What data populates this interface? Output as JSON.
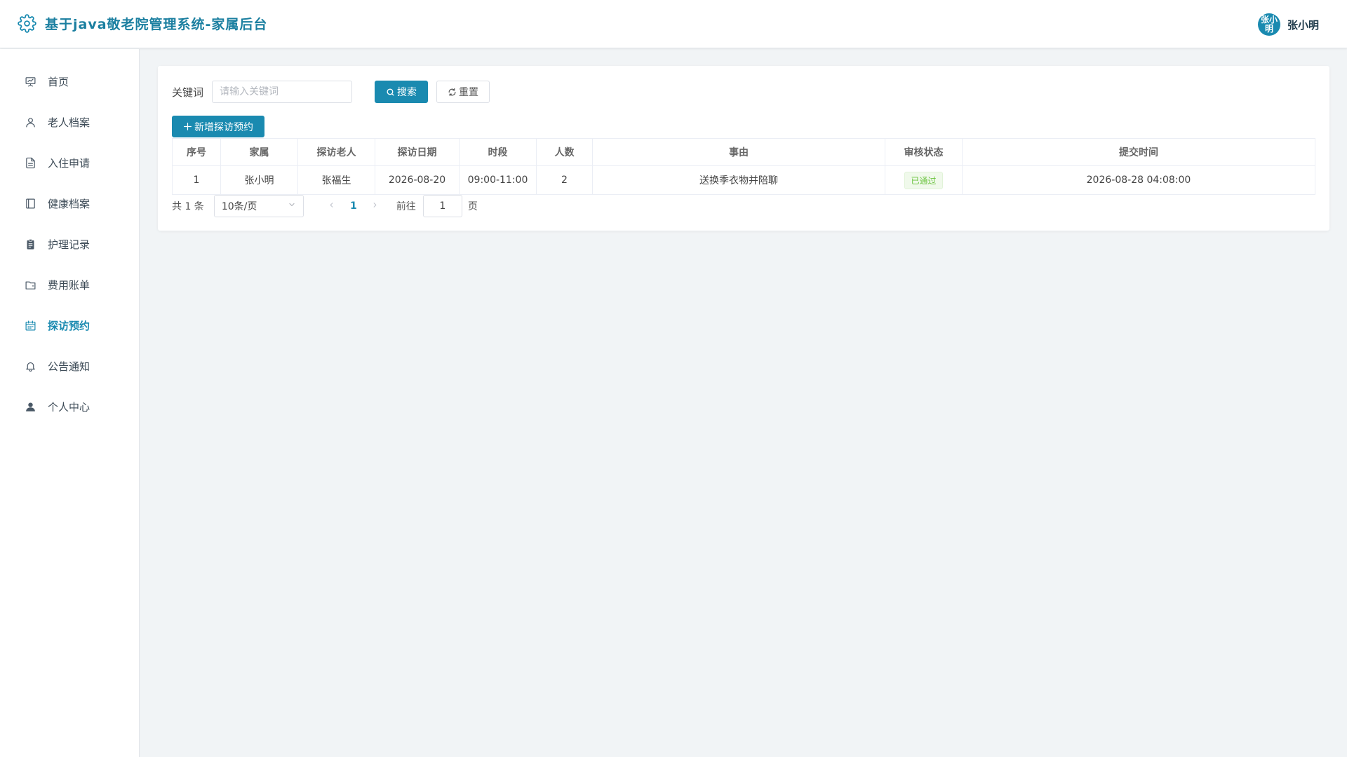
{
  "app": {
    "title": "基于java敬老院管理系统-家属后台"
  },
  "user": {
    "avatar_text": "张小明",
    "name": "张小明"
  },
  "sidebar": {
    "items": [
      {
        "label": "首页",
        "icon": "presentation-icon",
        "active": false
      },
      {
        "label": "老人档案",
        "icon": "user-icon",
        "active": false
      },
      {
        "label": "入住申请",
        "icon": "document-icon",
        "active": false
      },
      {
        "label": "健康档案",
        "icon": "notebook-icon",
        "active": false
      },
      {
        "label": "护理记录",
        "icon": "clipboard-icon",
        "active": false
      },
      {
        "label": "费用账单",
        "icon": "wallet-icon",
        "active": false
      },
      {
        "label": "探访预约",
        "icon": "calendar-icon",
        "active": true
      },
      {
        "label": "公告通知",
        "icon": "bell-icon",
        "active": false
      },
      {
        "label": "个人中心",
        "icon": "person-filled-icon",
        "active": false
      }
    ]
  },
  "search": {
    "label": "关键词",
    "placeholder": "请输入关键词",
    "search_label": "搜索",
    "reset_label": "重置"
  },
  "toolbar": {
    "add_label": "新增探访预约"
  },
  "table": {
    "columns": [
      "序号",
      "家属",
      "探访老人",
      "探访日期",
      "时段",
      "人数",
      "事由",
      "审核状态",
      "提交时间"
    ],
    "rows": [
      [
        "1",
        "张小明",
        "张福生",
        "2026-08-20",
        "09:00-11:00",
        "2",
        "送换季衣物并陪聊",
        "已通过",
        "2026-08-28 04:08:00"
      ]
    ]
  },
  "pagination": {
    "total_text": "共 1 条",
    "page_size": "10条/页",
    "current_page": "1",
    "goto_label": "前往",
    "goto_value": "1",
    "page_suffix": "页"
  },
  "colors": {
    "accent": "#1a8ab0",
    "success": "#67c23a",
    "background": "#f1f4f6"
  }
}
